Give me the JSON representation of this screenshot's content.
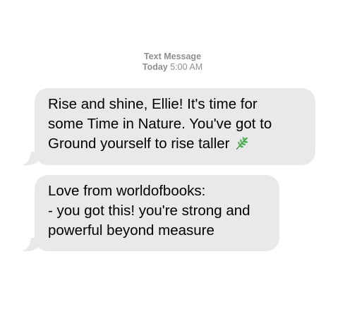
{
  "header": {
    "label": "Text Message",
    "day": "Today",
    "time": "5:00 AM"
  },
  "messages": [
    {
      "lines": [
        "Rise and shine, Ellie! It's time for",
        "some Time in Nature. You've got to",
        "Ground yourself to rise taller"
      ],
      "emoji": "herb-icon"
    },
    {
      "lines": [
        "Love from worldofbooks:",
        "- you got this! you're strong and",
        "powerful beyond measure"
      ]
    }
  ],
  "colors": {
    "bubble_background": "#e9e9eb",
    "header_text": "#8e8e93",
    "leaf_green": "#4caf50"
  }
}
